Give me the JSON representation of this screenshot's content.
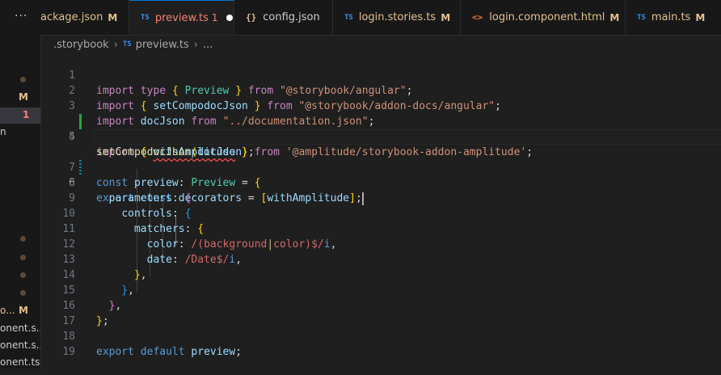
{
  "sidebar": {
    "more_label": "···",
    "badge_m1": "M",
    "badge_error_count": "1",
    "partial_text_1": "n",
    "rows": [
      {
        "text": "o...",
        "badge": "M"
      },
      {
        "text": "onent.s..."
      },
      {
        "text": "onent.s..."
      },
      {
        "text": "onent.ts"
      }
    ]
  },
  "tabs": [
    {
      "label": "ackage.json",
      "badge": "M",
      "icon": "json-icon"
    },
    {
      "label": "preview.ts",
      "badge": "1",
      "icon": "typescript-icon",
      "icon_text": "TS",
      "active": true
    },
    {
      "label": "config.json",
      "icon": "json-icon",
      "icon_text": "{}"
    },
    {
      "label": "login.stories.ts",
      "badge": "M",
      "icon": "typescript-icon",
      "icon_text": "TS"
    },
    {
      "label": "login.component.html",
      "badge": "M",
      "icon": "html-icon",
      "icon_text": "<>"
    },
    {
      "label": "main.ts",
      "badge": "M",
      "icon": "typescript-icon",
      "icon_text": "TS"
    }
  ],
  "breadcrumb": {
    "folder": ".storybook",
    "file_icon": "TS",
    "file": "preview.ts",
    "symbol": "..."
  },
  "editor": {
    "line_numbers": [
      "1",
      "2",
      "3",
      "4",
      "5",
      "6",
      "7",
      "8",
      "9",
      "10",
      "11",
      "12",
      "13",
      "14",
      "15",
      "16",
      "17",
      "18",
      "19"
    ],
    "lines": {
      "l1": {
        "a": "import",
        "b": "type",
        "c": "{",
        "d": "Preview",
        "e": "}",
        "f": "from",
        "g": "\"@storybook/angular\"",
        "h": ";"
      },
      "l2": {
        "a": "import",
        "c": "{",
        "d": "setCompodocJson",
        "e": "}",
        "f": "from",
        "g": "\"@storybook/addon-docs/angular\"",
        "h": ";"
      },
      "l3": {
        "a": "import",
        "d": "docJson",
        "f": "from",
        "g": "\"../documentation.json\"",
        "h": ";"
      },
      "l4": {
        "a": "import",
        "c": "{",
        "d": "withAmplitude",
        "e": "}",
        "f": "from",
        "g": "'@amplitude/storybook-addon-amplitude'",
        "h": ";"
      },
      "l5": {
        "a": "setCompodocJson",
        "b": "(",
        "c": "docJson",
        "d": ")",
        "e": ";"
      },
      "l6": {
        "a": "export",
        "b": "const",
        "c": "decorators",
        "d": "=",
        "e": "[",
        "f": "withAmplitude",
        "g": "]",
        "h": ";"
      },
      "l7": {
        "a": "const",
        "b": "preview",
        "c": ":",
        "d": "Preview",
        "e": "=",
        "f": "{"
      },
      "l8": {
        "a": "parameters",
        "b": ":",
        "c": "{"
      },
      "l9": {
        "a": "controls",
        "b": ":",
        "c": "{"
      },
      "l10": {
        "a": "matchers",
        "b": ":",
        "c": "{"
      },
      "l11": {
        "a": "color",
        "b": ":",
        "c": "/(background",
        "d": "|",
        "e": "color)$/",
        "f": "i",
        ",": ","
      },
      "l12": {
        "a": "date",
        "b": ":",
        "c": "/Date$/",
        "d": "i",
        "e": ","
      },
      "l13": {
        "a": "}",
        "b": ","
      },
      "l14": {
        "a": "}",
        "b": ","
      },
      "l15": {
        "a": "}",
        "b": ","
      },
      "l16": {
        "a": "}",
        "b": ";"
      },
      "l18": {
        "a": "export",
        "b": "default",
        "c": "preview",
        "d": ";"
      }
    }
  },
  "colors": {
    "accent": "#0078d4",
    "modified": "#e2c08d",
    "error": "#f88070",
    "added_gutter": "#2ea043",
    "modified_gutter": "#0c7d9d"
  }
}
